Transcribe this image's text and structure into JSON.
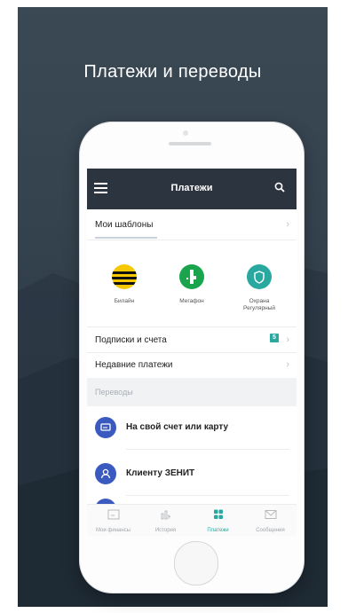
{
  "promo": {
    "title": "Платежи и переводы"
  },
  "appbar": {
    "title": "Платежи",
    "menu_icon": "hamburger-icon",
    "search_icon": "search-icon"
  },
  "templates": {
    "label": "Мои шаблоны"
  },
  "quick_payments": [
    {
      "label": "Билайн",
      "icon": "beeline-logo-icon",
      "color": "#f5c800"
    },
    {
      "label": "Мегафон",
      "icon": "megafon-logo-icon",
      "color": "#1aa44b"
    },
    {
      "label_line1": "Охрана",
      "label_line2": "Регулярный",
      "icon": "shield-icon",
      "color": "#29a8a0"
    }
  ],
  "subscriptions": {
    "label": "Подписки и счета",
    "badge": "5"
  },
  "recent": {
    "label": "Недавние платежи"
  },
  "transfers": {
    "section_label": "Переводы",
    "items": [
      {
        "label": "На свой счет или карту",
        "icon": "card-transfer-icon"
      },
      {
        "label": "Клиенту ЗЕНИТ",
        "icon": "user-icon"
      }
    ]
  },
  "tabbar": {
    "tabs": [
      {
        "label": "Мои финансы",
        "icon": "wallet-icon",
        "active": false
      },
      {
        "label": "История",
        "icon": "history-chart-icon",
        "active": false
      },
      {
        "label": "Платежи",
        "icon": "grid-icon",
        "active": true
      },
      {
        "label": "Сообщения",
        "icon": "envelope-icon",
        "active": false
      }
    ]
  },
  "colors": {
    "accent": "#29a8a0",
    "appbar": "#2b343f",
    "transfer_icon": "#3b5ac0"
  }
}
